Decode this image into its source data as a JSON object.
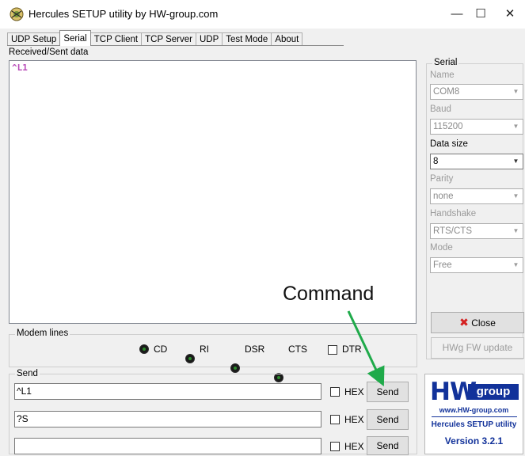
{
  "window": {
    "title": "Hercules SETUP utility by HW-group.com",
    "minimize_glyph": "—",
    "maximize_glyph": "☐",
    "close_glyph": "✕"
  },
  "tabs": [
    {
      "label": "UDP Setup"
    },
    {
      "label": "Serial",
      "active": true
    },
    {
      "label": "TCP Client"
    },
    {
      "label": "TCP Server"
    },
    {
      "label": "UDP"
    },
    {
      "label": "Test Mode"
    },
    {
      "label": "About"
    }
  ],
  "received": {
    "label": "Received/Sent data",
    "content": "^L1",
    "content_color": "#b84ab8"
  },
  "serial": {
    "group_label": "Serial",
    "name_label": "Name",
    "name_value": "COM8",
    "baud_label": "Baud",
    "baud_value": "115200",
    "datasize_label": "Data size",
    "datasize_value": "8",
    "parity_label": "Parity",
    "parity_value": "none",
    "handshake_label": "Handshake",
    "handshake_value": "RTS/CTS",
    "mode_label": "Mode",
    "mode_value": "Free",
    "close_label": "Close",
    "close_icon": "red-x-icon",
    "fw_update_label": "HWg FW update"
  },
  "modem": {
    "group_label": "Modem lines",
    "leds": [
      {
        "label": "CD"
      },
      {
        "label": "RI"
      },
      {
        "label": "DSR"
      },
      {
        "label": "CTS"
      }
    ],
    "dtr_label": "DTR"
  },
  "send": {
    "group_label": "Send",
    "rows": [
      {
        "value": "^L1",
        "hex_label": "HEX",
        "button": "Send"
      },
      {
        "value": "?S",
        "hex_label": "HEX",
        "button": "Send"
      },
      {
        "value": "",
        "hex_label": "HEX",
        "button": "Send"
      }
    ]
  },
  "logo": {
    "hw": "HW",
    "group": "group",
    "url": "www.HW-group.com",
    "product": "Hercules SETUP utility",
    "version": "Version  3.2.1"
  },
  "annotation": {
    "text": "Command",
    "arrow_color": "#1faa4a"
  }
}
